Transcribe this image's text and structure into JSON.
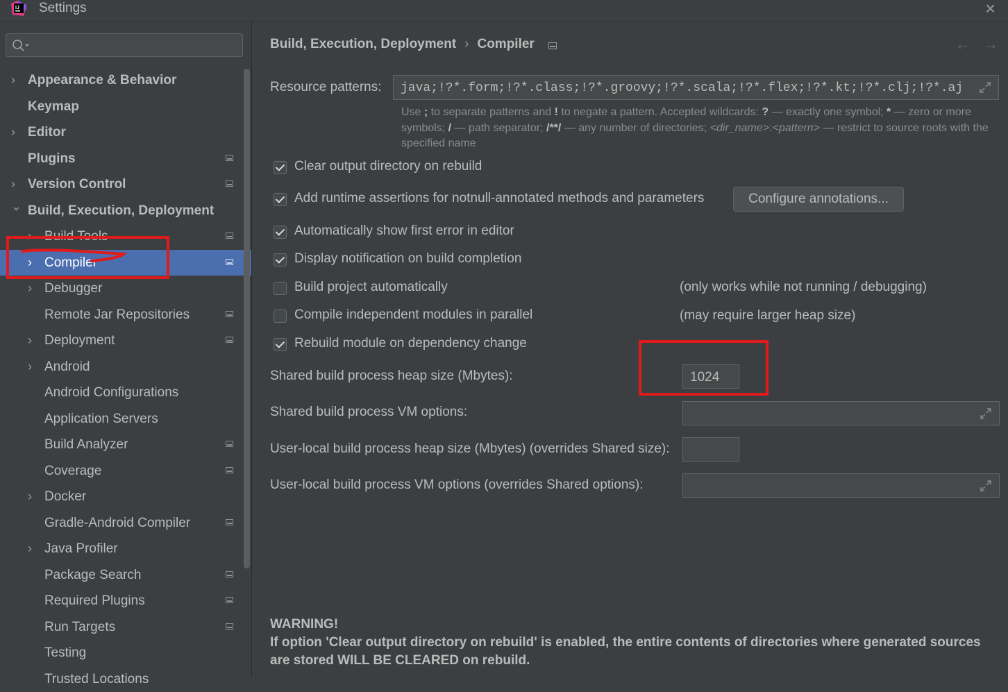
{
  "window": {
    "title": "Settings"
  },
  "search": {
    "placeholder": ""
  },
  "sidebar": {
    "items": [
      {
        "label": "Appearance & Behavior",
        "chevron": true,
        "bold": true,
        "project": false
      },
      {
        "label": "Keymap",
        "chevron": false,
        "bold": true,
        "project": false
      },
      {
        "label": "Editor",
        "chevron": true,
        "bold": true,
        "project": false
      },
      {
        "label": "Plugins",
        "chevron": false,
        "bold": true,
        "project": true
      },
      {
        "label": "Version Control",
        "chevron": true,
        "bold": true,
        "project": true
      },
      {
        "label": "Build, Execution, Deployment",
        "chevron": true,
        "expanded": true,
        "bold": true,
        "project": false
      },
      {
        "label": "Build Tools",
        "chevron": true,
        "indent": true,
        "project": true
      },
      {
        "label": "Compiler",
        "chevron": true,
        "indent": true,
        "project": true,
        "selected": true
      },
      {
        "label": "Debugger",
        "chevron": true,
        "indent": true,
        "project": false
      },
      {
        "label": "Remote Jar Repositories",
        "chevron": false,
        "indent": true,
        "project": true
      },
      {
        "label": "Deployment",
        "chevron": true,
        "indent": true,
        "project": true
      },
      {
        "label": "Android",
        "chevron": true,
        "indent": true,
        "project": false
      },
      {
        "label": "Android Configurations",
        "chevron": false,
        "indent": true,
        "project": false
      },
      {
        "label": "Application Servers",
        "chevron": false,
        "indent": true,
        "project": false
      },
      {
        "label": "Build Analyzer",
        "chevron": false,
        "indent": true,
        "project": true
      },
      {
        "label": "Coverage",
        "chevron": false,
        "indent": true,
        "project": true
      },
      {
        "label": "Docker",
        "chevron": true,
        "indent": true,
        "project": false
      },
      {
        "label": "Gradle-Android Compiler",
        "chevron": false,
        "indent": true,
        "project": true
      },
      {
        "label": "Java Profiler",
        "chevron": true,
        "indent": true,
        "project": false
      },
      {
        "label": "Package Search",
        "chevron": false,
        "indent": true,
        "project": true
      },
      {
        "label": "Required Plugins",
        "chevron": false,
        "indent": true,
        "project": true
      },
      {
        "label": "Run Targets",
        "chevron": false,
        "indent": true,
        "project": true
      },
      {
        "label": "Testing",
        "chevron": false,
        "indent": true,
        "project": false
      },
      {
        "label": "Trusted Locations",
        "chevron": false,
        "indent": true,
        "project": false
      }
    ]
  },
  "breadcrumb": {
    "parent": "Build, Execution, Deployment",
    "separator": "›",
    "current": "Compiler"
  },
  "resource_patterns": {
    "label": "Resource patterns:",
    "value": "java;!?*.form;!?*.class;!?*.groovy;!?*.scala;!?*.flex;!?*.kt;!?*.clj;!?*.aj"
  },
  "hint": {
    "p1": "Use ",
    "b1": ";",
    "p2": " to separate patterns and ",
    "b2": "!",
    "p3": " to negate a pattern. Accepted wildcards: ",
    "b3": "?",
    "p4": " — exactly one symbol; ",
    "b4": "*",
    "p5": " — zero or more symbols; ",
    "b5": "/",
    "p6": " — path separator; ",
    "b6": "/**/",
    "p7": " — any number of directories; ",
    "i1": "<dir_name>",
    "p8": ":",
    "i2": "<pattern>",
    "p9": " — restrict to source roots with the specified name"
  },
  "options": {
    "clear_output": {
      "label": "Clear output directory on rebuild",
      "checked": true
    },
    "runtime_assertions": {
      "label": "Add runtime assertions for notnull-annotated methods and parameters",
      "checked": true
    },
    "configure_button": "Configure annotations...",
    "show_first_error": {
      "label": "Automatically show first error in editor",
      "checked": true
    },
    "display_notification": {
      "label": "Display notification on build completion",
      "checked": true
    },
    "build_auto": {
      "label": "Build project automatically",
      "checked": false,
      "note": "(only works while not running / debugging)"
    },
    "compile_parallel": {
      "label": "Compile independent modules in parallel",
      "checked": false,
      "note": "(may require larger heap size)"
    },
    "rebuild_module": {
      "label": "Rebuild module on dependency change",
      "checked": true
    }
  },
  "fields": {
    "shared_heap": {
      "label": "Shared build process heap size (Mbytes):",
      "value": "1024"
    },
    "shared_vm": {
      "label": "Shared build process VM options:",
      "value": ""
    },
    "user_heap": {
      "label": "User-local build process heap size (Mbytes) (overrides Shared size):",
      "value": ""
    },
    "user_vm": {
      "label": "User-local build process VM options (overrides Shared options):",
      "value": ""
    }
  },
  "warning": {
    "title": "WARNING!",
    "text": "If option 'Clear output directory on rebuild' is enabled, the entire contents of directories where generated sources are stored WILL BE CLEARED on rebuild."
  },
  "colors": {
    "background": "#3c3f41",
    "selection": "#4b6eaf",
    "annotation": "#e01b1b",
    "text": "#bbbbbb"
  }
}
